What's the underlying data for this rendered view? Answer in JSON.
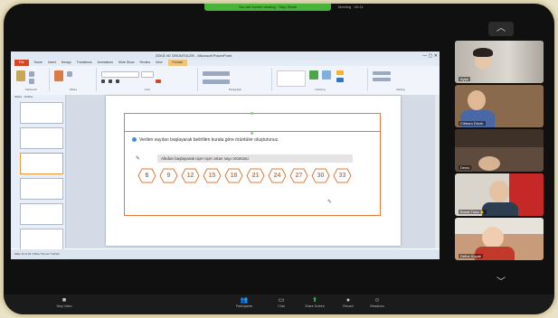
{
  "zoom_bar": {
    "share_label": "You are screen sharing  ·  Stop Share",
    "info": "Meeting · 00:41"
  },
  "ppt": {
    "window_title": "ZEKÂ VE ÖRÜNTÜLER - Microsoft PowerPoint",
    "tabs": [
      "Home",
      "Insert",
      "Design",
      "Transitions",
      "Animations",
      "Slide Show",
      "Review",
      "View",
      "Format"
    ],
    "file_tab": "File",
    "tools_tab": "Drawing Tools",
    "ribbon_groups": [
      "Clipboard",
      "Slides",
      "Font",
      "Paragraph",
      "Drawing",
      "Editing"
    ],
    "pane_tabs": [
      "Slides",
      "Outline"
    ],
    "question": "Verilen sayıları başlayarak belirtilen kurala göre örüntüler oluşturunuz.",
    "instruction": "Altıdan başlayarak üçer üçer artan sayı örüntüsü",
    "sequence": [
      "6",
      "9",
      "12",
      "15",
      "18",
      "21",
      "24",
      "27",
      "30",
      "33"
    ],
    "status": "Slide 13 of 22   \"Office Theme\"   Turkish"
  },
  "participants": [
    {
      "name": "Ayşe",
      "bg": "#c7c3bd"
    },
    {
      "name": "Cihhanı Dövür",
      "bg": "#8a6a4c"
    },
    {
      "name": "Deniz",
      "bg": "#5f4b3d"
    },
    {
      "name": "Burak Tuna  ✋",
      "bg": "#d9d4cc"
    },
    {
      "name": "Defne Koçak",
      "bg": "#c89c7a"
    }
  ],
  "toolbar": {
    "items": [
      {
        "icon": "video",
        "label": "Stop Video"
      },
      {
        "icon": "people",
        "label": "Participants"
      },
      {
        "icon": "chat",
        "label": "Chat"
      },
      {
        "icon": "share",
        "label": "Share Screen"
      },
      {
        "icon": "record",
        "label": "Record"
      },
      {
        "icon": "reactions",
        "label": "Reactions"
      }
    ]
  },
  "colors": {
    "accent_orange": "#e07a3a",
    "zoom_green": "#4ab43a",
    "ppt_file_red": "#d24726"
  }
}
